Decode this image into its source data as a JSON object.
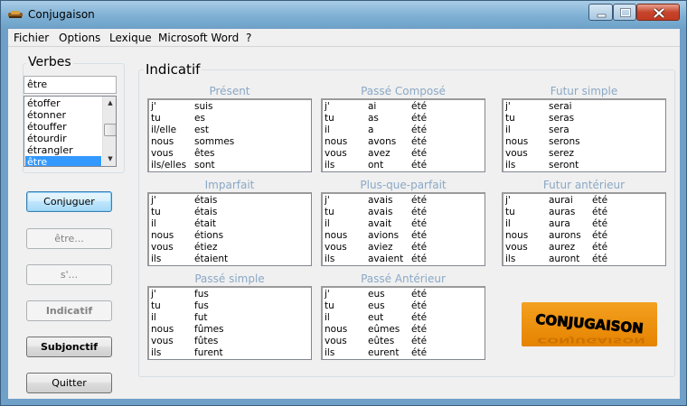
{
  "window": {
    "title": "Conjugaison"
  },
  "menu": [
    "Fichier",
    "Options",
    "Lexique",
    "Microsoft Word",
    "?"
  ],
  "verbes": {
    "label": "Verbes",
    "search_value": "être",
    "list": [
      "étoffer",
      "étonner",
      "étouffer",
      "étourdir",
      "étrangler",
      "être"
    ],
    "selected": "être"
  },
  "buttons": {
    "conjuguer": "Conjuguer",
    "etre": "être...",
    "s": "s'...",
    "indicatif": "Indicatif",
    "subjonctif": "Subjonctif",
    "quitter": "Quitter"
  },
  "mode": {
    "label": "Indicatif"
  },
  "tenses": [
    {
      "name": "Présent",
      "rows": [
        [
          "j'",
          "suis",
          ""
        ],
        [
          "tu",
          "es",
          ""
        ],
        [
          "il/elle",
          "est",
          ""
        ],
        [
          "nous",
          "sommes",
          ""
        ],
        [
          "vous",
          "êtes",
          ""
        ],
        [
          "ils/elles",
          "sont",
          ""
        ]
      ]
    },
    {
      "name": "Passé Composé",
      "rows": [
        [
          "j'",
          "ai",
          "été"
        ],
        [
          "tu",
          "as",
          "été"
        ],
        [
          "il",
          "a",
          "été"
        ],
        [
          "nous",
          "avons",
          "été"
        ],
        [
          "vous",
          "avez",
          "été"
        ],
        [
          "ils",
          "ont",
          "été"
        ]
      ]
    },
    {
      "name": "Futur simple",
      "rows": [
        [
          "j'",
          "serai",
          ""
        ],
        [
          "tu",
          "seras",
          ""
        ],
        [
          "il",
          "sera",
          ""
        ],
        [
          "nous",
          "serons",
          ""
        ],
        [
          "vous",
          "serez",
          ""
        ],
        [
          "ils",
          "seront",
          ""
        ]
      ]
    },
    {
      "name": "Imparfait",
      "rows": [
        [
          "j'",
          "étais",
          ""
        ],
        [
          "tu",
          "étais",
          ""
        ],
        [
          "il",
          "était",
          ""
        ],
        [
          "nous",
          "étions",
          ""
        ],
        [
          "vous",
          "étiez",
          ""
        ],
        [
          "ils",
          "étaient",
          ""
        ]
      ]
    },
    {
      "name": "Plus-que-parfait",
      "rows": [
        [
          "j'",
          "avais",
          "été"
        ],
        [
          "tu",
          "avais",
          "été"
        ],
        [
          "il",
          "avait",
          "été"
        ],
        [
          "nous",
          "avions",
          "été"
        ],
        [
          "vous",
          "aviez",
          "été"
        ],
        [
          "ils",
          "avaient",
          "été"
        ]
      ]
    },
    {
      "name": "Futur antérieur",
      "rows": [
        [
          "j'",
          "aurai",
          "été"
        ],
        [
          "tu",
          "auras",
          "été"
        ],
        [
          "il",
          "aura",
          "été"
        ],
        [
          "nous",
          "aurons",
          "été"
        ],
        [
          "vous",
          "aurez",
          "été"
        ],
        [
          "ils",
          "auront",
          "été"
        ]
      ]
    },
    {
      "name": "Passé simple",
      "rows": [
        [
          "j'",
          "fus",
          ""
        ],
        [
          "tu",
          "fus",
          ""
        ],
        [
          "il",
          "fut",
          ""
        ],
        [
          "nous",
          "fûmes",
          ""
        ],
        [
          "vous",
          "fûtes",
          ""
        ],
        [
          "ils",
          "furent",
          ""
        ]
      ]
    },
    {
      "name": "Passé Antérieur",
      "rows": [
        [
          "j'",
          "eus",
          "été"
        ],
        [
          "tu",
          "eus",
          "été"
        ],
        [
          "il",
          "eut",
          "été"
        ],
        [
          "nous",
          "eûmes",
          "été"
        ],
        [
          "vous",
          "eûtes",
          "été"
        ],
        [
          "ils",
          "eurent",
          "été"
        ]
      ]
    }
  ],
  "logo": {
    "text": "CONJUGAISON",
    "bg": "#f09010"
  },
  "colors": {
    "tense_title": "#8aa8c6",
    "selection": "#3399ff"
  }
}
